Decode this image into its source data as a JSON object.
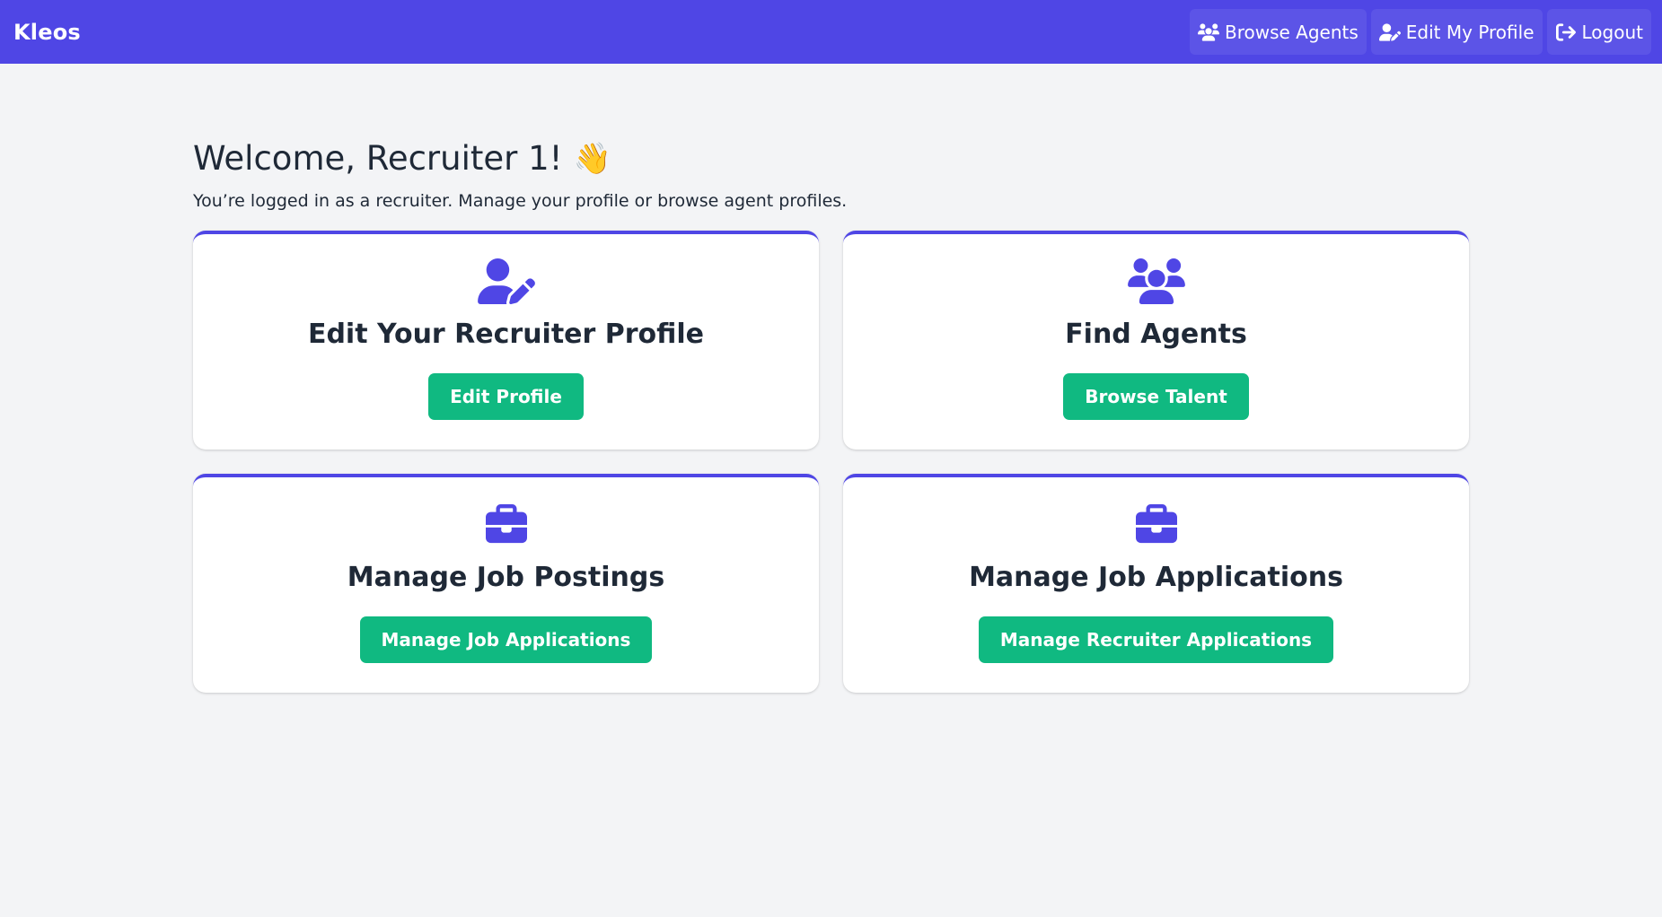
{
  "nav": {
    "brand": "Kleos",
    "links": [
      {
        "label": "Browse Agents",
        "icon": "users-icon"
      },
      {
        "label": "Edit My Profile",
        "icon": "user-pen-icon"
      },
      {
        "label": "Logout",
        "icon": "logout-icon"
      }
    ]
  },
  "main": {
    "welcome": "Welcome, Recruiter 1!",
    "wave_emoji": "👋",
    "subtitle": "You’re logged in as a recruiter. Manage your profile or browse agent profiles."
  },
  "cards": [
    {
      "title": "Edit Your Recruiter Profile",
      "button": "Edit Profile",
      "icon": "user-pen-icon"
    },
    {
      "title": "Find Agents",
      "button": "Browse Talent",
      "icon": "users-icon"
    },
    {
      "title": "Manage Job Postings",
      "button": "Manage Job Applications",
      "icon": "briefcase-icon"
    },
    {
      "title": "Manage Job Applications",
      "button": "Manage Recruiter Applications",
      "icon": "briefcase-icon"
    }
  ],
  "colors": {
    "primary": "#4f46e5",
    "button": "#10b981",
    "background": "#f3f4f6"
  }
}
